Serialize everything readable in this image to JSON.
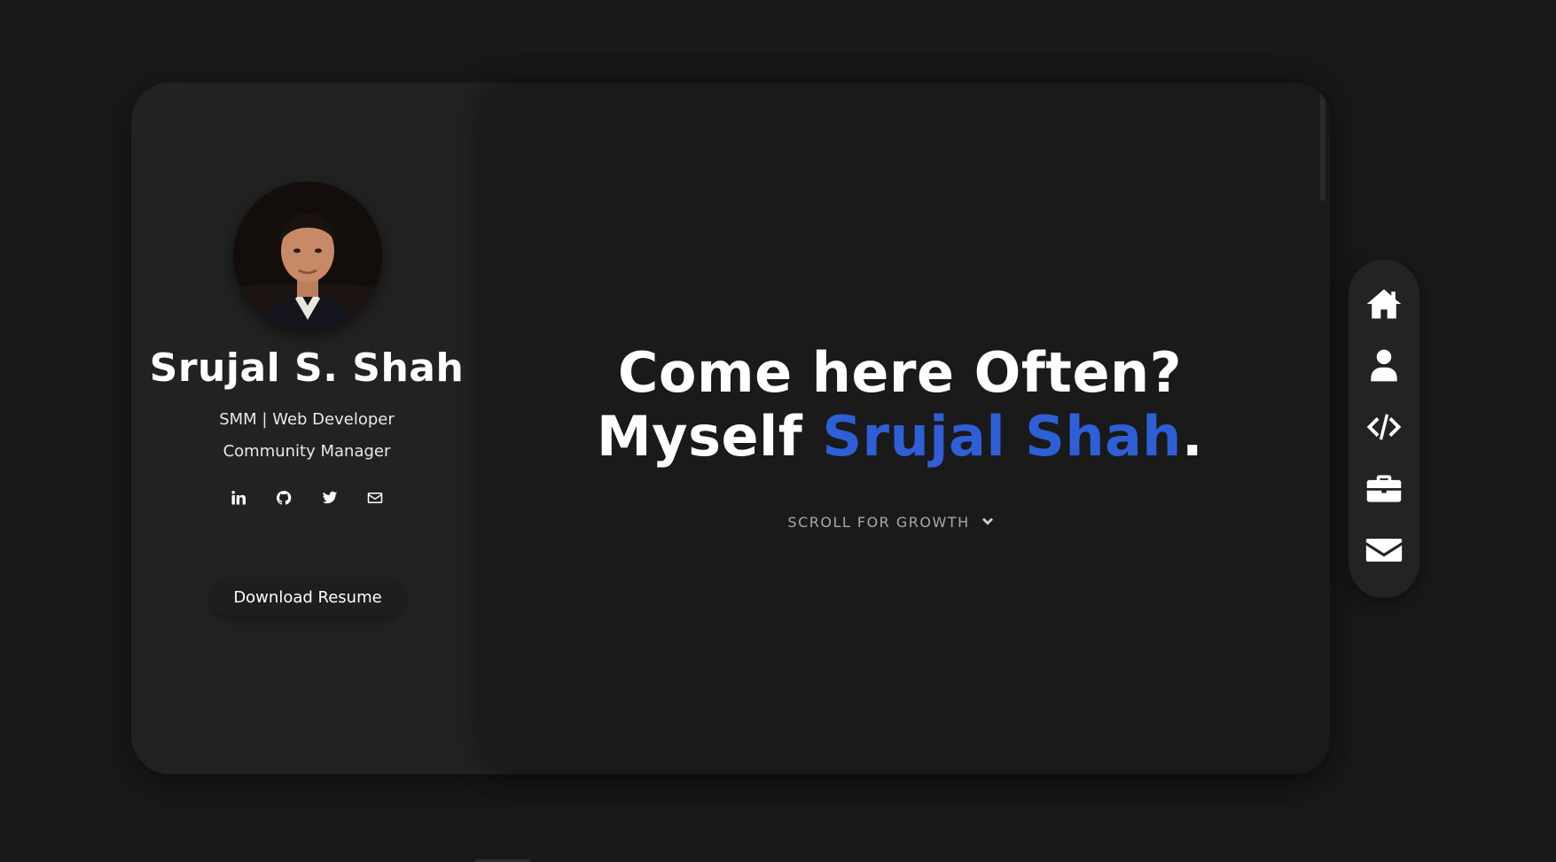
{
  "colors": {
    "background": "#191919",
    "panel": "#222222",
    "accent": "#2f5fd6"
  },
  "profile": {
    "name": "Srujal S. Shah",
    "role_line1": "SMM | Web Developer",
    "role_line2": "Community Manager",
    "social_icons": [
      "linkedin-icon",
      "github-icon",
      "twitter-icon",
      "email-icon"
    ],
    "resume_button": "Download Resume"
  },
  "hero": {
    "line1": "Come here Often?",
    "line2_prefix": "Myself ",
    "line2_name": "Srujal Shah",
    "line2_suffix": ".",
    "scroll_hint": "SCROLL FOR GROWTH"
  },
  "nav": {
    "items": [
      "home-icon",
      "user-icon",
      "code-icon",
      "briefcase-icon",
      "envelope-icon"
    ]
  }
}
